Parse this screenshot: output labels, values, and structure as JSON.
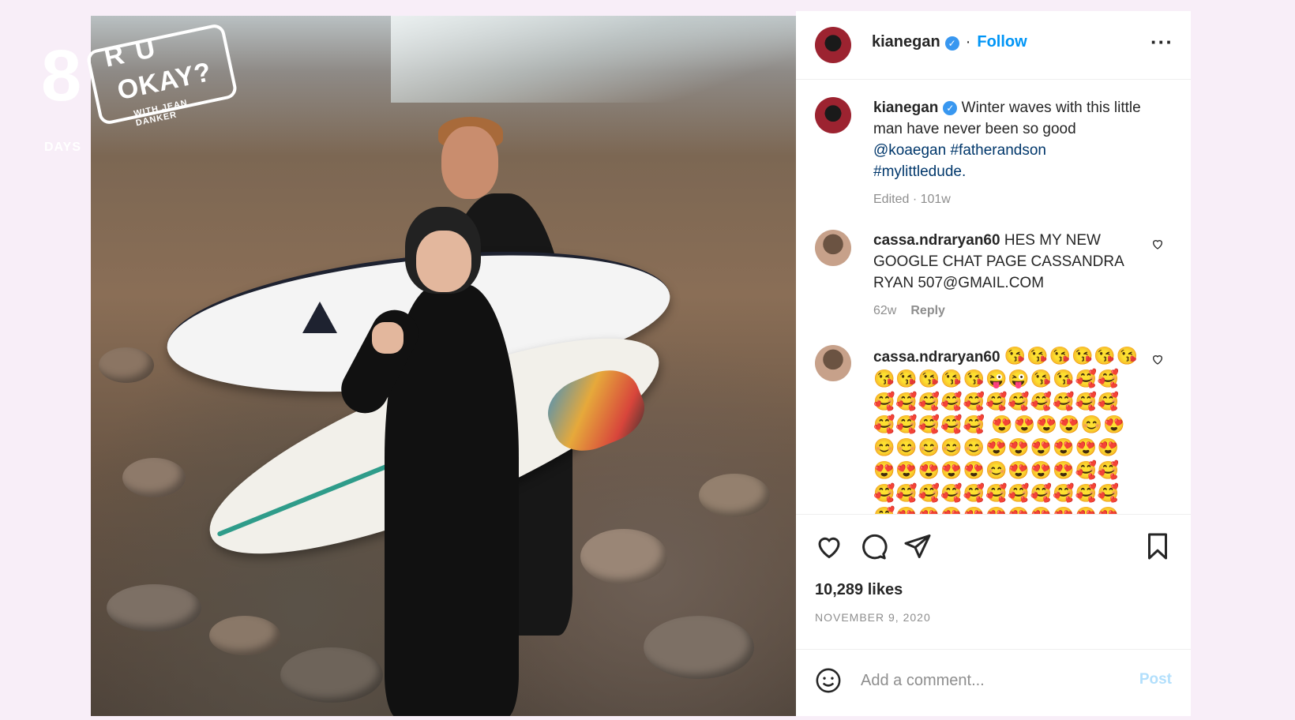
{
  "watermark": {
    "number": "8",
    "line1": "R U",
    "line2": "OKAY?",
    "sub": "WITH JEAN DANKER",
    "days": "DAYS"
  },
  "post": {
    "header": {
      "username": "kianegan",
      "separator": "·",
      "follow_label": "Follow",
      "more_label": "···"
    },
    "caption": {
      "username": "kianegan",
      "text": "Winter waves with this little man have never been so good",
      "mention": "@koaegan",
      "hashtag1": "#fatherandson",
      "hashtag2": "#mylittledude.",
      "meta": "Edited · 101w"
    },
    "comments": [
      {
        "username": "cassa.ndraryan60",
        "text": "HES MY NEW GOOGLE CHAT PAGE CASSANDRA RYAN 507@GMAIL.COM",
        "time": "62w",
        "reply_label": "Reply"
      },
      {
        "username": "cassa.ndraryan60",
        "emojis": "😘😘😘😘😘😘😘😘😘😘😘😜😜😘😘🥰🥰🥰🥰🥰🥰🥰🥰🥰🥰🥰🥰🥰🥰🥰🥰🥰🥰 😍😍😍😍😊😍😊😊😊😊😊😍😍😍😍😍😍😍😍😍😍😍😊😍😍😍🥰🥰🥰🥰🥰🥰🥰🥰🥰🥰🥰🥰🥰🥰😍😍😍😍😍😍😍😍😍😍😍😍"
      }
    ],
    "likes": "10,289 likes",
    "date": "NOVEMBER 9, 2020",
    "comment_placeholder": "Add a comment...",
    "post_label": "Post"
  },
  "colors": {
    "link_blue": "#0095f6",
    "verified_blue": "#3897f0",
    "post_disabled": "#b2dffc",
    "background": "#f8eef8"
  },
  "icons": [
    "heart-icon",
    "comment-icon",
    "share-icon",
    "bookmark-icon",
    "smile-icon",
    "verified-icon",
    "more-icon"
  ]
}
